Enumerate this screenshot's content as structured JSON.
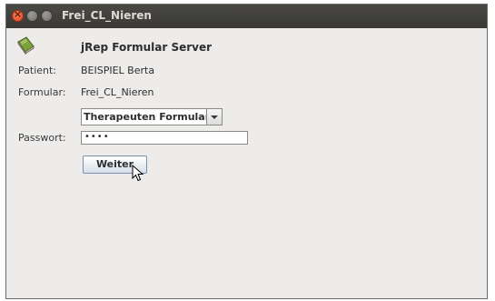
{
  "window": {
    "title": "Frei_CL_Nieren"
  },
  "app": {
    "title": "jRep Formular Server",
    "icon": "book-icon"
  },
  "form": {
    "patient_label": "Patient:",
    "patient_value": "BEISPIEL Berta",
    "formular_label": "Formular:",
    "formular_value": "Frei_CL_Nieren",
    "combo_selected": "Therapeuten Formular",
    "password_label": "Passwort:",
    "password_masked": "••••",
    "submit_label": "Weiter"
  },
  "colors": {
    "titlebar": "#3c3b37",
    "background": "#edeceb",
    "close": "#e0441c"
  }
}
